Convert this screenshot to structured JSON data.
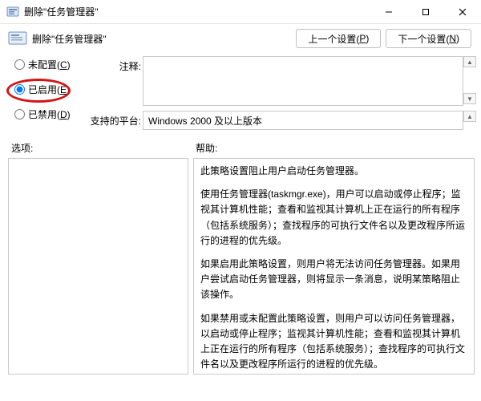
{
  "window": {
    "title": "删除\"任务管理器\""
  },
  "header": {
    "title": "删除\"任务管理器\""
  },
  "nav": {
    "prev_label_pre": "上一个设置(",
    "prev_accel": "P",
    "prev_label_post": ")",
    "next_label_pre": "下一个设置(",
    "next_accel": "N",
    "next_label_post": ")"
  },
  "radios": {
    "not_configured_pre": "未配置(",
    "not_configured_accel": "C",
    "not_configured_post": ")",
    "enabled_pre": "已启用(",
    "enabled_accel": "E",
    "enabled_post": ")",
    "disabled_pre": "已禁用(",
    "disabled_accel": "D",
    "disabled_post": ")",
    "selected": "enabled"
  },
  "labels": {
    "comment": "注释:",
    "platform": "支持的平台:",
    "options": "选项:",
    "help": "帮助:"
  },
  "fields": {
    "comment_value": "",
    "platform_value": "Windows 2000 及以上版本"
  },
  "help": {
    "p1": "此策略设置阻止用户启动任务管理器。",
    "p2": "使用任务管理器(taskmgr.exe)，用户可以启动或停止程序；监视其计算机性能；查看和监视其计算机上正在运行的所有程序（包括系统服务）；查找程序的可执行文件名以及更改程序所运行的进程的优先级。",
    "p3": "如果启用此策略设置，则用户将无法访问任务管理器。如果用户尝试启动任务管理器，则将显示一条消息，说明某策略阻止该操作。",
    "p4": "如果禁用或未配置此策略设置，则用户可以访问任务管理器，以启动或停止程序；监视其计算机性能；查看和监视其计算机上正在运行的所有程序（包括系统服务）；查找程序的可执行文件名以及更改程序所运行的进程的优先级。"
  }
}
